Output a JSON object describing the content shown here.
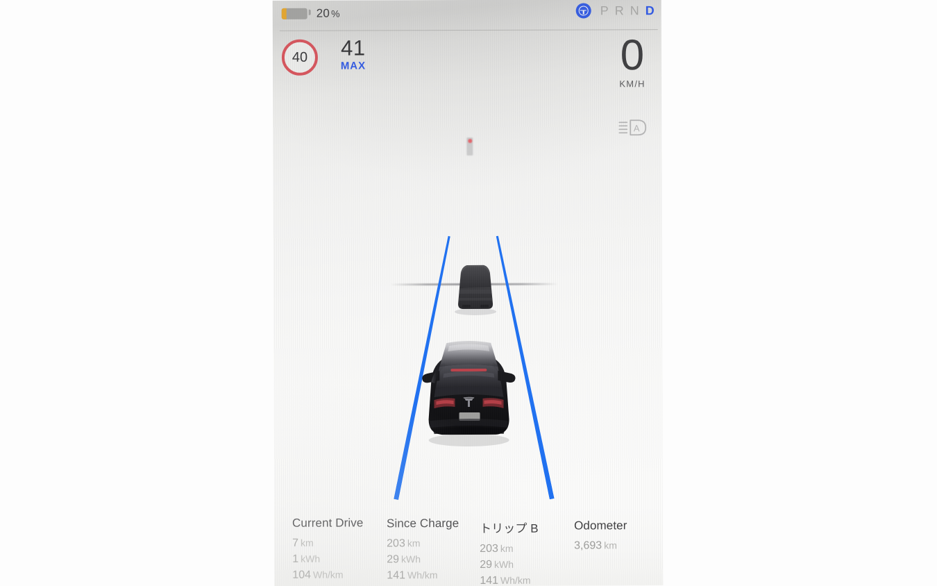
{
  "status_bar": {
    "battery_percent": "20",
    "battery_unit": "%",
    "battery_level_fraction": 0.2,
    "battery_fill_color": "#e8a72a",
    "autopilot_icon": "steering-wheel-icon",
    "autopilot_active": true,
    "autopilot_color": "#2b56e8",
    "gears": [
      {
        "letter": "P",
        "active": false
      },
      {
        "letter": "R",
        "active": false
      },
      {
        "letter": "N",
        "active": false
      },
      {
        "letter": "D",
        "active": true
      }
    ]
  },
  "speed_limit": {
    "value": "40",
    "ring_color": "#d9525a"
  },
  "max_speed": {
    "value": "41",
    "label": "MAX",
    "color": "#2b56e8"
  },
  "current_speed": {
    "value": "0",
    "unit": "KM/H"
  },
  "indicators": {
    "auto_headlight_icon": "auto-headlight-icon",
    "auto_headlight_letter": "A"
  },
  "scene": {
    "lane_line_color": "#1f71f2",
    "lead_vehicle": "dark-gray-car",
    "ego_vehicle": "black-tesla-rear-view",
    "traffic_light_state": "red",
    "road_surface_color": "#f4f4f3"
  },
  "trip_panel": {
    "columns": [
      {
        "title": "Current Drive",
        "rows": [
          {
            "num": "7",
            "unit": "km"
          },
          {
            "num": "1",
            "unit": "kWh"
          },
          {
            "num": "104",
            "unit": "Wh/km"
          }
        ]
      },
      {
        "title": "Since Charge",
        "rows": [
          {
            "num": "203",
            "unit": "km"
          },
          {
            "num": "29",
            "unit": "kWh"
          },
          {
            "num": "141",
            "unit": "Wh/km"
          }
        ]
      },
      {
        "title": "トリップ B",
        "rows": [
          {
            "num": "203",
            "unit": "km"
          },
          {
            "num": "29",
            "unit": "kWh"
          },
          {
            "num": "141",
            "unit": "Wh/km"
          }
        ]
      },
      {
        "title": "Odometer",
        "rows": [
          {
            "num": "3,693",
            "unit": "km"
          }
        ]
      }
    ]
  }
}
